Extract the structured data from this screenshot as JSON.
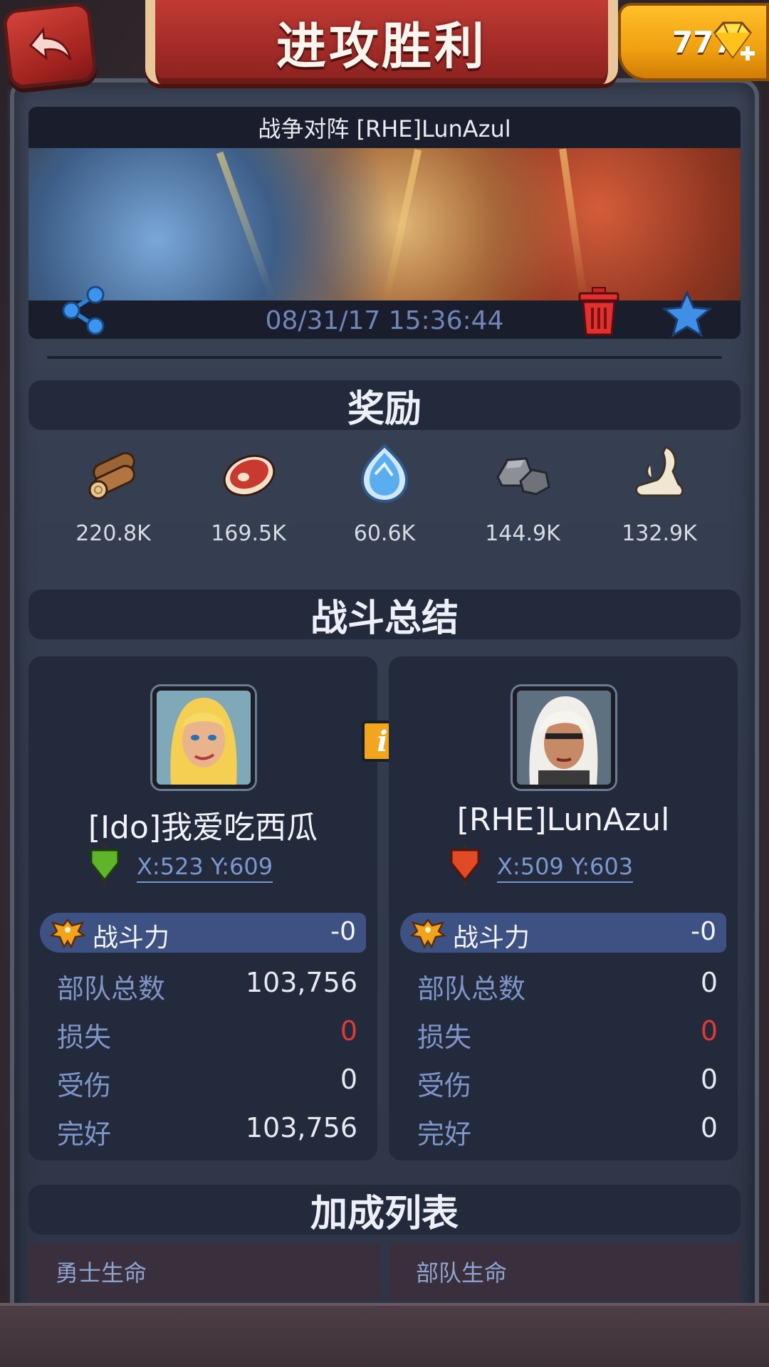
{
  "header": {
    "title": "进攻胜利",
    "gems": "777"
  },
  "battle": {
    "title": "战争对阵 [RHE]LunAzul",
    "timestamp": "08/31/17 15:36:44"
  },
  "rewards": {
    "heading": "奖励",
    "items": [
      {
        "icon": "wood-icon",
        "value": "220.8K"
      },
      {
        "icon": "meat-icon",
        "value": "169.5K"
      },
      {
        "icon": "crystal-icon",
        "value": "60.6K"
      },
      {
        "icon": "stone-icon",
        "value": "144.9K"
      },
      {
        "icon": "bone-icon",
        "value": "132.9K"
      }
    ]
  },
  "summary": {
    "heading": "战斗总结",
    "attacker": {
      "name": "[Ido]我爱吃西瓜",
      "coords": "X:523 Y:609",
      "flag_color": "#5fb52a",
      "power_label": "战斗力",
      "power_value": "-0",
      "stats": [
        {
          "label": "部队总数",
          "value": "103,756"
        },
        {
          "label": "损失",
          "value": "0"
        },
        {
          "label": "受伤",
          "value": "0"
        },
        {
          "label": "完好",
          "value": "103,756"
        }
      ]
    },
    "defender": {
      "name": "[RHE]LunAzul",
      "coords": "X:509 Y:603",
      "flag_color": "#e04a24",
      "power_label": "战斗力",
      "power_value": "-0",
      "stats": [
        {
          "label": "部队总数",
          "value": "0"
        },
        {
          "label": "损失",
          "value": "0"
        },
        {
          "label": "受伤",
          "value": "0"
        },
        {
          "label": "完好",
          "value": "0"
        }
      ]
    },
    "info_glyph": "i"
  },
  "bonus": {
    "heading": "加成列表",
    "cells": [
      "勇士生命",
      "部队生命"
    ]
  },
  "colors": {
    "accent_blue": "#3d5283",
    "loss_red": "#e03a38",
    "gold": "#f0a010"
  }
}
